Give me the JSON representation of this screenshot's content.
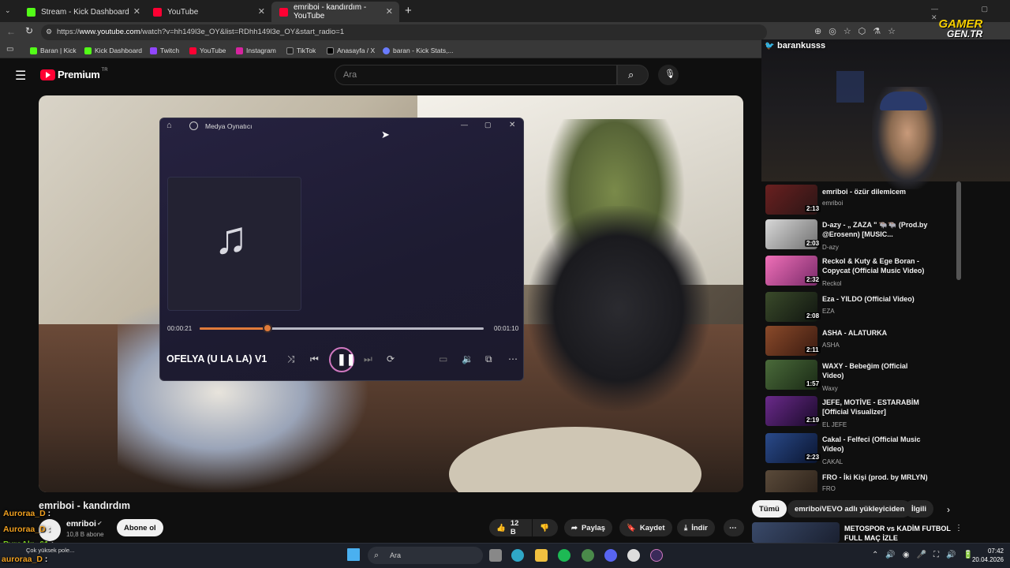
{
  "browser": {
    "tabs": [
      {
        "label": "Stream - Kick Dashboard",
        "color": "#53fc18"
      },
      {
        "label": "YouTube",
        "color": "#ff0033"
      },
      {
        "label": "emriboi - kandırdım - YouTube",
        "color": "#ff0033"
      }
    ],
    "url_prefix": "https://",
    "url_host": "www.youtube.com",
    "url_path": "/watch?v=hh149l3e_OY&list=RDhh149l3e_OY&start_radio=1",
    "bookmarks": [
      "Baran | Kick",
      "Kick Dashboard",
      "Twitch",
      "YouTube",
      "Instagram",
      "TikTok",
      "Anasayfa / X",
      "baran - Kick Stats,..."
    ]
  },
  "youtube": {
    "logo": "Premium",
    "logo_badge": "TR",
    "search_placeholder": "Ara",
    "video_title": "emriboi - kandırdım",
    "channel_name": "emriboi",
    "subscribers": "10,8 B abone",
    "subscribe_label": "Abone ol",
    "likes": "12 B",
    "share": "Paylaş",
    "save": "Kaydet",
    "download": "İndir",
    "chips": [
      "Tümü",
      "emriboiVEVO adlı yükleyiciden",
      "İlgili"
    ],
    "recommendations": [
      {
        "title": "emriboi - özür dilemicem",
        "channel": "emriboi",
        "duration": "2:13"
      },
      {
        "title": "D-azy - „ ZAZA \" 🐃🐃 (Prod.by @Erosenn) [MUSIC...",
        "channel": "D-azy",
        "duration": "2:03"
      },
      {
        "title": "Reckol & Kuty & Ege Boran - Copycat (Official Music Video)",
        "channel": "Reckol",
        "duration": "2:32"
      },
      {
        "title": "Eza - YILDO (Official Video)",
        "channel": "EZA",
        "duration": "2:08"
      },
      {
        "title": "ASHA - ALATURKA",
        "channel": "ASHA",
        "duration": "2:11"
      },
      {
        "title": "WAXY - Bebeğim (Official Video)",
        "channel": "Waxy",
        "duration": "1:57"
      },
      {
        "title": "JEFE, MOTİVE - ESTARABİM [Official Visualizer]",
        "channel": "EL JEFE",
        "duration": "2:19"
      },
      {
        "title": "Cakal - Felfeci (Official Music Video)",
        "channel": "CAKAL",
        "duration": "2:23"
      },
      {
        "title": "FRO - İki Kişi (prod. by MRLYN)",
        "channel": "FRO",
        "duration": ""
      }
    ],
    "next_card_title": "METOSPOR vs KADİM FUTBOL FULL MAÇ İZLE"
  },
  "media_player": {
    "app_title": "Medya Oynatıcı",
    "song_title": "OFELYA (U LA LA) V1",
    "time_current": "00:00:21",
    "time_total": "00:01:10",
    "progress": 0.24
  },
  "overlay": {
    "twitter_handle": "barankusss",
    "watermark_top": "GAMER",
    "watermark_bottom": "GEN.TR",
    "chat": [
      {
        "user": "Auroraa_D",
        "text": ":",
        "color": "#f0a020"
      },
      {
        "user": "Auroraa_D",
        "text": ":",
        "color": "#f0a020"
      },
      {
        "user": "PyroAlp_61",
        "text": ":",
        "color": "#7ed321"
      },
      {
        "user": "auroraa_D",
        "text": ":",
        "color": "#f0a020"
      }
    ],
    "notification": "Çok yüksek pole..."
  },
  "taskbar": {
    "search": "Ara",
    "time": "07:42",
    "date": "20.04.2026"
  }
}
